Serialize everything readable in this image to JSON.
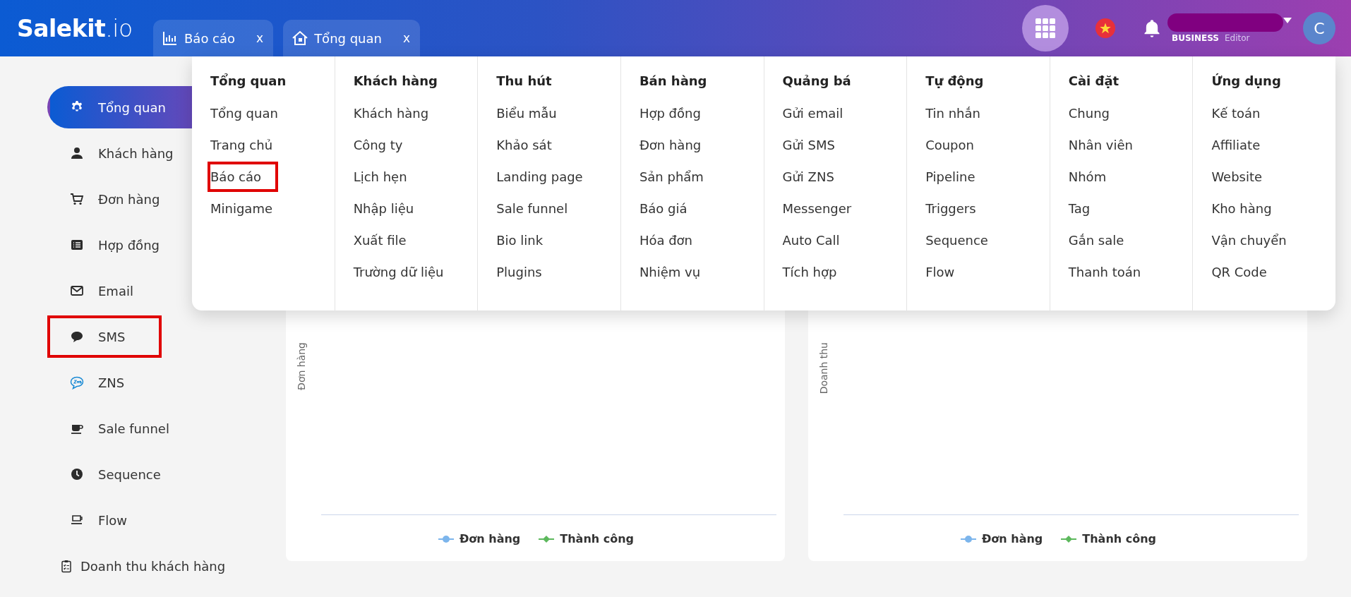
{
  "header": {
    "logo": "**Salekit**.io",
    "tabs": [
      {
        "label": "Báo cáo",
        "close": "x"
      },
      {
        "label": "Tổng quan",
        "close": "x"
      }
    ],
    "account": {
      "plan": "BUSINESS",
      "role": "Editor",
      "avatar": "C"
    }
  },
  "sidebar": {
    "items": [
      {
        "label": "Tổng quan",
        "kind": "main",
        "selected": true,
        "highlighted": false
      },
      {
        "label": "Khách hàng",
        "kind": "main",
        "selected": false,
        "highlighted": false
      },
      {
        "label": "Đơn hàng",
        "kind": "main",
        "selected": false,
        "highlighted": false
      },
      {
        "label": "Hợp đồng",
        "kind": "main",
        "selected": false,
        "highlighted": false
      },
      {
        "label": "Email",
        "kind": "main",
        "selected": false,
        "highlighted": false
      },
      {
        "label": "SMS",
        "kind": "main",
        "selected": false,
        "highlighted": true
      },
      {
        "label": "ZNS",
        "kind": "main",
        "selected": false,
        "highlighted": false
      },
      {
        "label": "Sale funnel",
        "kind": "main",
        "selected": false,
        "highlighted": false
      },
      {
        "label": "Sequence",
        "kind": "main",
        "selected": false,
        "highlighted": false
      },
      {
        "label": "Flow",
        "kind": "main",
        "selected": false,
        "highlighted": false
      },
      {
        "label": "Doanh thu khách hàng",
        "kind": "sub",
        "selected": false,
        "highlighted": false
      }
    ]
  },
  "mega_menu": {
    "columns": [
      {
        "title": "Tổng quan",
        "items": [
          {
            "label": "Tổng quan",
            "highlighted": false
          },
          {
            "label": "Trang chủ",
            "highlighted": false
          },
          {
            "label": "Báo cáo",
            "highlighted": true
          },
          {
            "label": "Minigame",
            "highlighted": false
          }
        ]
      },
      {
        "title": "Khách hàng",
        "items": [
          {
            "label": "Khách hàng",
            "highlighted": false
          },
          {
            "label": "Công ty",
            "highlighted": false
          },
          {
            "label": "Lịch hẹn",
            "highlighted": false
          },
          {
            "label": "Nhập liệu",
            "highlighted": false
          },
          {
            "label": "Xuất file",
            "highlighted": false
          },
          {
            "label": "Trường dữ liệu",
            "highlighted": false
          }
        ]
      },
      {
        "title": "Thu hút",
        "items": [
          {
            "label": "Biểu mẫu",
            "highlighted": false
          },
          {
            "label": "Khảo sát",
            "highlighted": false
          },
          {
            "label": "Landing page",
            "highlighted": false
          },
          {
            "label": "Sale funnel",
            "highlighted": false
          },
          {
            "label": "Bio link",
            "highlighted": false
          },
          {
            "label": "Plugins",
            "highlighted": false
          }
        ]
      },
      {
        "title": "Bán hàng",
        "items": [
          {
            "label": "Hợp đồng",
            "highlighted": false
          },
          {
            "label": "Đơn hàng",
            "highlighted": false
          },
          {
            "label": "Sản phẩm",
            "highlighted": false
          },
          {
            "label": "Báo giá",
            "highlighted": false
          },
          {
            "label": "Hóa đơn",
            "highlighted": false
          },
          {
            "label": "Nhiệm vụ",
            "highlighted": false
          }
        ]
      },
      {
        "title": "Quảng bá",
        "items": [
          {
            "label": "Gửi email",
            "highlighted": false
          },
          {
            "label": "Gửi SMS",
            "highlighted": false
          },
          {
            "label": "Gửi ZNS",
            "highlighted": false
          },
          {
            "label": "Messenger",
            "highlighted": false
          },
          {
            "label": "Auto Call",
            "highlighted": false
          },
          {
            "label": "Tích hợp",
            "highlighted": false
          }
        ]
      },
      {
        "title": "Tự động",
        "items": [
          {
            "label": "Tin nhắn",
            "highlighted": false
          },
          {
            "label": "Coupon",
            "highlighted": false
          },
          {
            "label": "Pipeline",
            "highlighted": false
          },
          {
            "label": "Triggers",
            "highlighted": false
          },
          {
            "label": "Sequence",
            "highlighted": false
          },
          {
            "label": "Flow",
            "highlighted": false
          }
        ]
      },
      {
        "title": "Cài đặt",
        "items": [
          {
            "label": "Chung",
            "highlighted": false
          },
          {
            "label": "Nhân viên",
            "highlighted": false
          },
          {
            "label": "Nhóm",
            "highlighted": false
          },
          {
            "label": "Tag",
            "highlighted": false
          },
          {
            "label": "Gắn sale",
            "highlighted": false
          },
          {
            "label": "Thanh toán",
            "highlighted": false
          }
        ]
      },
      {
        "title": "Ứng dụng",
        "items": [
          {
            "label": "Kế toán",
            "highlighted": false
          },
          {
            "label": "Affiliate",
            "highlighted": false
          },
          {
            "label": "Website",
            "highlighted": false
          },
          {
            "label": "Kho hàng",
            "highlighted": false
          },
          {
            "label": "Vận chuyển",
            "highlighted": false
          },
          {
            "label": "QR Code",
            "highlighted": false
          }
        ]
      }
    ]
  },
  "charts": [
    {
      "ylabel": "Đơn hàng",
      "legend": [
        {
          "label": "Đơn hàng",
          "color": "#7cb5ec",
          "kind": "circle"
        },
        {
          "label": "Thành công",
          "color": "#5cb85c",
          "kind": "diamond"
        }
      ]
    },
    {
      "ylabel": "Doanh thu",
      "legend": [
        {
          "label": "Đơn hàng",
          "color": "#7cb5ec",
          "kind": "circle"
        },
        {
          "label": "Thành công",
          "color": "#5cb85c",
          "kind": "diamond"
        }
      ]
    }
  ]
}
